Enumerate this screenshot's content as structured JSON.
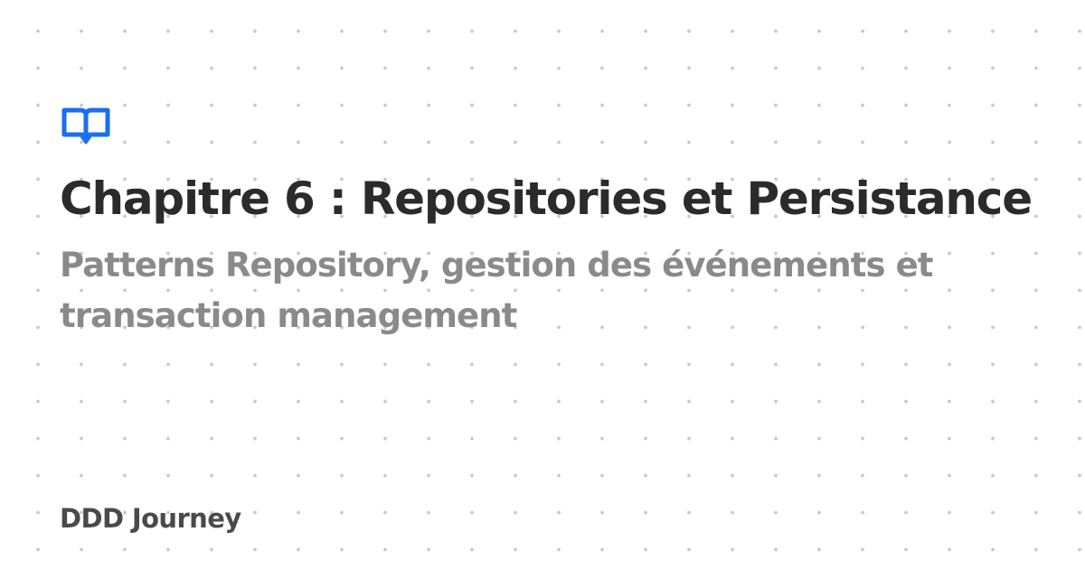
{
  "card": {
    "icon": "book-open-icon",
    "title": "Chapitre 6 : Repositories et Persistance",
    "subtitle": "Patterns Repository, gestion des événements et transaction management",
    "brand": "DDD Journey"
  },
  "colors": {
    "accent": "#1a6ef0",
    "title": "#2b2b2b",
    "subtitle": "#8a8a8a",
    "brand": "#4a4a4a",
    "dots": "#c9c9c9",
    "background": "#ffffff"
  }
}
